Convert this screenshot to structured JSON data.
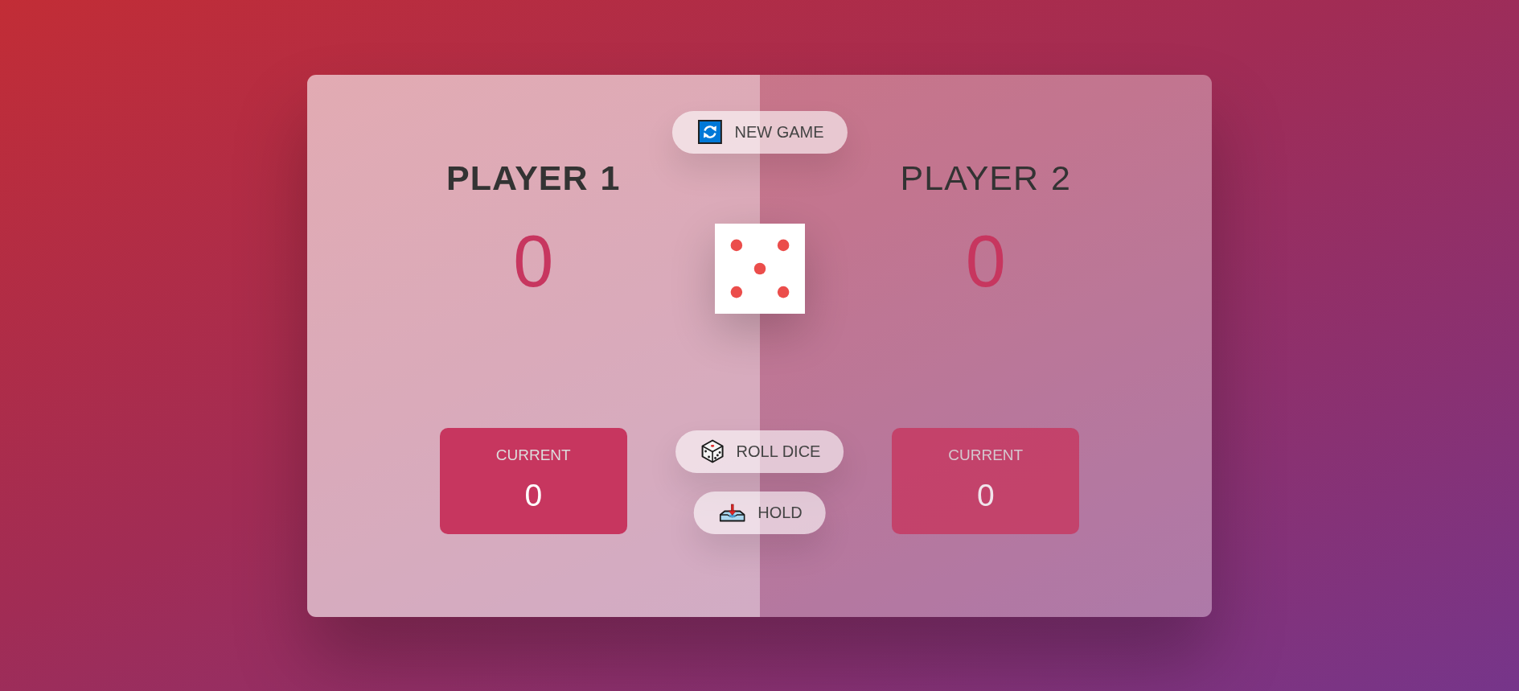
{
  "players": [
    {
      "name": "PLAYER 1",
      "score": "0",
      "current_label": "CURRENT",
      "current_score": "0",
      "active": true
    },
    {
      "name": "PLAYER 2",
      "score": "0",
      "current_label": "CURRENT",
      "current_score": "0",
      "active": false
    }
  ],
  "dice": {
    "kind": "five"
  },
  "buttons": [
    {
      "kind": "new",
      "label": "NEW GAME"
    },
    {
      "kind": "roll",
      "label": "ROLL DICE"
    },
    {
      "kind": "hold",
      "label": "HOLD"
    }
  ]
}
